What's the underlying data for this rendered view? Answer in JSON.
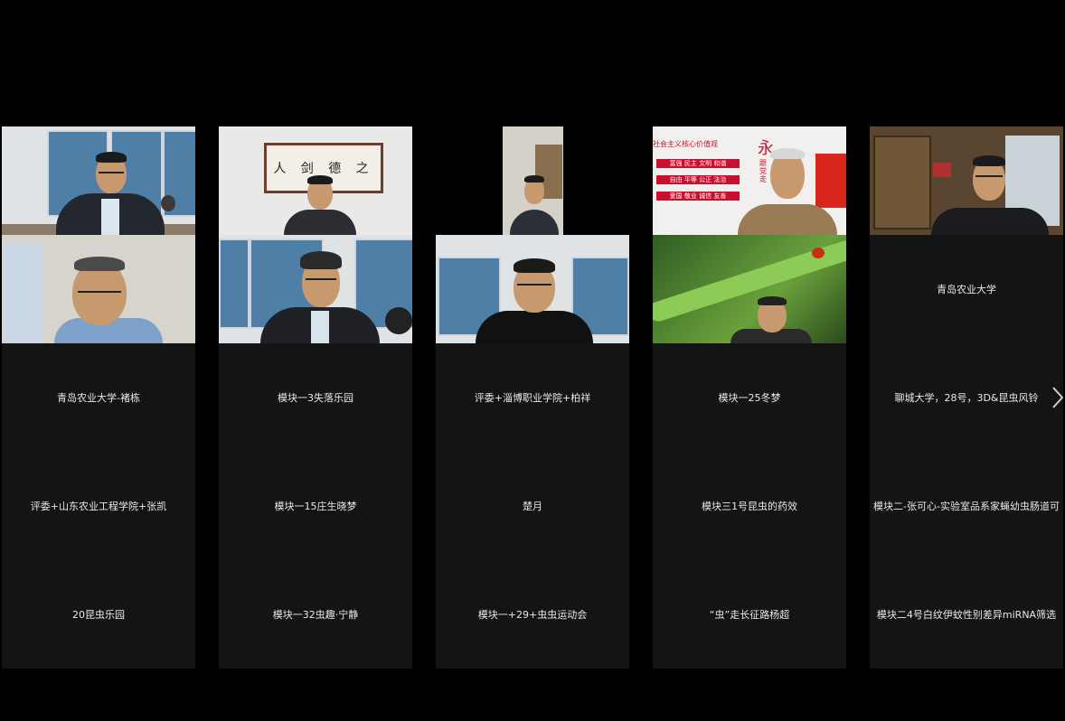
{
  "columns": [
    {
      "tiles": [
        {
          "kind": "video",
          "label": ""
        },
        {
          "kind": "video",
          "label": ""
        },
        {
          "kind": "name",
          "label": "青岛农业大学-褚栋"
        },
        {
          "kind": "name",
          "label": "评委+山东农业工程学院+张凯"
        },
        {
          "kind": "name",
          "label": "20昆虫乐园"
        }
      ]
    },
    {
      "tiles": [
        {
          "kind": "video",
          "label": ""
        },
        {
          "kind": "video",
          "label": ""
        },
        {
          "kind": "name",
          "label": "模块一3失落乐园"
        },
        {
          "kind": "name",
          "label": "模块一15庄生晓梦"
        },
        {
          "kind": "name",
          "label": "模块一32虫趣·宁静"
        }
      ]
    },
    {
      "tiles": [
        {
          "kind": "video",
          "label": ""
        },
        {
          "kind": "video",
          "label": ""
        },
        {
          "kind": "name",
          "label": "评委+淄博职业学院+柏祥"
        },
        {
          "kind": "name",
          "label": "楚月"
        },
        {
          "kind": "name",
          "label": "模块一+29+虫虫运动会"
        }
      ]
    },
    {
      "tiles": [
        {
          "kind": "video",
          "label": ""
        },
        {
          "kind": "video",
          "label": ""
        },
        {
          "kind": "name",
          "label": "模块一25冬梦"
        },
        {
          "kind": "name",
          "label": "模块三1号昆虫的药效"
        },
        {
          "kind": "name",
          "label": "“虫”走长征路杨超"
        }
      ]
    },
    {
      "tiles": [
        {
          "kind": "video",
          "label": ""
        },
        {
          "kind": "name",
          "label": "青岛农业大学"
        },
        {
          "kind": "name",
          "label": "聊城大学，28号，3D&昆虫风铃"
        },
        {
          "kind": "name",
          "label": "模块二-张可心-实验室品系家蝇幼虫肠道可"
        },
        {
          "kind": "name",
          "label": "模块二4号白纹伊蚊性别差异miRNA筛选"
        }
      ]
    }
  ],
  "calligraphy": "人 剑 德 之",
  "banner_text": "社会主义核心价值观",
  "banner_red_char": "永",
  "banner_sub": "跟党走",
  "values_rows": [
    "富强 民主 文明 和谐",
    "自由 平等 公正 法治",
    "爱国 敬业 诚信 友善"
  ],
  "navigation": {
    "next_icon": "chevron-right-icon"
  },
  "colors": {
    "background": "#000000",
    "tile": "#141414",
    "label": "#e8e8e8"
  }
}
